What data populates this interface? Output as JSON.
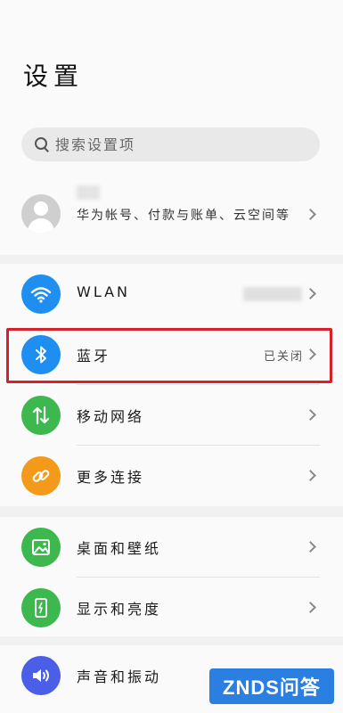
{
  "header": {
    "title": "设置"
  },
  "search": {
    "placeholder": "搜索设置项"
  },
  "account": {
    "desc": "华为帐号、付款与账单、云空间等"
  },
  "group1": [
    {
      "label": "WLAN",
      "icon": "wifi-icon",
      "color": "#1e8ef0"
    },
    {
      "label": "蓝牙",
      "value": "已关闭",
      "icon": "bluetooth-icon",
      "color": "#1e8ef0"
    },
    {
      "label": "移动网络",
      "icon": "mobile-data-icon",
      "color": "#3cb84e"
    },
    {
      "label": "更多连接",
      "icon": "link-icon",
      "color": "#f39a1a"
    }
  ],
  "group2": [
    {
      "label": "桌面和壁纸",
      "icon": "image-icon",
      "color": "#3cb84e"
    },
    {
      "label": "显示和亮度",
      "icon": "display-icon",
      "color": "#3cb84e"
    }
  ],
  "group3": [
    {
      "label": "声音和振动",
      "icon": "volume-icon",
      "color": "#4a5ee8"
    }
  ],
  "watermark": {
    "text": "ZNDS问答"
  }
}
